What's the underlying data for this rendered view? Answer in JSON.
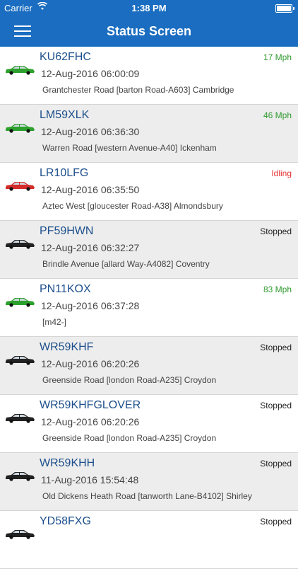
{
  "status_bar": {
    "carrier": "Carrier",
    "time": "1:38 PM",
    "battery_level": 1.0
  },
  "nav": {
    "title": "Status Screen",
    "menu_icon": "hamburger-menu-icon"
  },
  "vehicles": [
    {
      "plate": "KU62FHC",
      "datetime": "12-Aug-2016 06:00:09",
      "address": "Grantchester Road  [barton Road-A603] Cambridge",
      "status": "17 Mph",
      "status_color": "#2f9a2f",
      "car_color": "#2da12d"
    },
    {
      "plate": "LM59XLK",
      "datetime": "12-Aug-2016 06:36:30",
      "address": "Warren Road  [western Avenue-A40] Ickenham",
      "status": "46 Mph",
      "status_color": "#2f9a2f",
      "car_color": "#2da12d"
    },
    {
      "plate": "LR10LFG",
      "datetime": "12-Aug-2016 06:35:50",
      "address": "Aztec West  [gloucester Road-A38] Almondsbury",
      "status": "Idling",
      "status_color": "#e53030",
      "car_color": "#d42b2b"
    },
    {
      "plate": "PF59HWN",
      "datetime": "12-Aug-2016 06:32:27",
      "address": "Brindle Avenue  [allard Way-A4082] Coventry",
      "status": "Stopped",
      "status_color": "#222222",
      "car_color": "#222222"
    },
    {
      "plate": "PN11KOX",
      "datetime": "12-Aug-2016 06:37:28",
      "address": " [m42-]",
      "status": "83 Mph",
      "status_color": "#2f9a2f",
      "car_color": "#2da12d"
    },
    {
      "plate": "WR59KHF",
      "datetime": "12-Aug-2016 06:20:26",
      "address": "Greenside Road  [london Road-A235] Croydon",
      "status": "Stopped",
      "status_color": "#222222",
      "car_color": "#222222"
    },
    {
      "plate": "WR59KHFGLOVER",
      "datetime": "12-Aug-2016 06:20:26",
      "address": "Greenside Road  [london Road-A235] Croydon",
      "status": "Stopped",
      "status_color": "#222222",
      "car_color": "#222222"
    },
    {
      "plate": "WR59KHH",
      "datetime": "11-Aug-2016 15:54:48",
      "address": "Old Dickens Heath Road  [tanworth Lane-B4102] Shirley",
      "status": "Stopped",
      "status_color": "#222222",
      "car_color": "#222222"
    },
    {
      "plate": "YD58FXG",
      "datetime": "",
      "address": "",
      "status": "Stopped",
      "status_color": "#222222",
      "car_color": "#222222"
    }
  ]
}
